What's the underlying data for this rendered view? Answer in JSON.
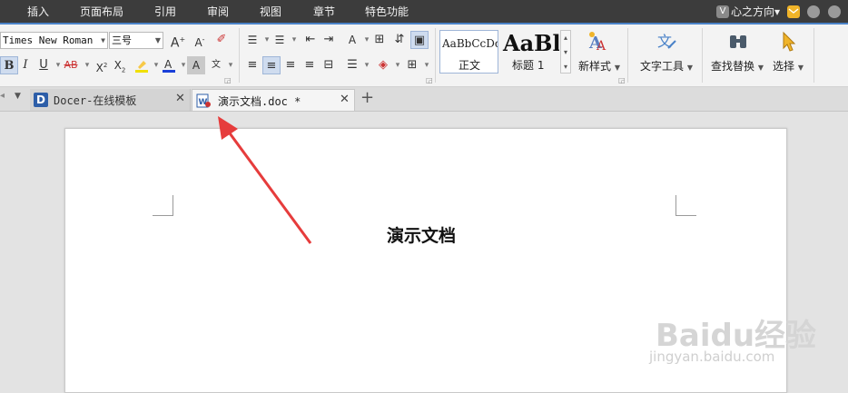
{
  "menu": {
    "items": [
      "插入",
      "页面布局",
      "引用",
      "审阅",
      "视图",
      "章节",
      "特色功能"
    ],
    "user": "心之方向▾"
  },
  "ribbon": {
    "font_name": "Times New Roman",
    "font_size": "三号",
    "styles": {
      "normal_preview": "AaBbCcDd",
      "normal_label": "正文",
      "heading_preview": "AaBl",
      "heading_label": "标题 1"
    },
    "new_style": "新样式",
    "text_tools": "文字工具",
    "find_replace": "查找替换",
    "select": "选择"
  },
  "tabs": {
    "docer": "Docer-在线模板",
    "doc": "演示文档.doc *"
  },
  "document": {
    "title": "演示文档"
  },
  "watermark": {
    "brand": "Baidu经验",
    "url": "jingyan.baidu.com"
  },
  "colors": {
    "menubar": "#3c3c3c",
    "accent": "#4a82c8",
    "arrow": "#e63c3c",
    "highlight": "#f0e000",
    "font_color": "#1a3fd8"
  }
}
